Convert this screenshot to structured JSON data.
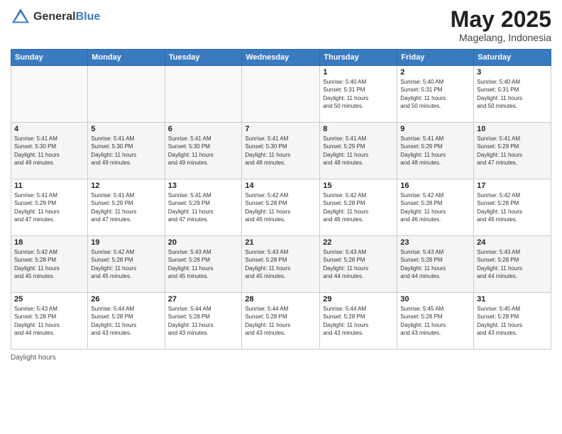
{
  "header": {
    "logo_general": "General",
    "logo_blue": "Blue",
    "month_year": "May 2025",
    "location": "Magelang, Indonesia"
  },
  "days_of_week": [
    "Sunday",
    "Monday",
    "Tuesday",
    "Wednesday",
    "Thursday",
    "Friday",
    "Saturday"
  ],
  "weeks": [
    [
      {
        "day": "",
        "info": ""
      },
      {
        "day": "",
        "info": ""
      },
      {
        "day": "",
        "info": ""
      },
      {
        "day": "",
        "info": ""
      },
      {
        "day": "1",
        "info": "Sunrise: 5:40 AM\nSunset: 5:31 PM\nDaylight: 11 hours\nand 50 minutes."
      },
      {
        "day": "2",
        "info": "Sunrise: 5:40 AM\nSunset: 5:31 PM\nDaylight: 11 hours\nand 50 minutes."
      },
      {
        "day": "3",
        "info": "Sunrise: 5:40 AM\nSunset: 5:31 PM\nDaylight: 11 hours\nand 50 minutes."
      }
    ],
    [
      {
        "day": "4",
        "info": "Sunrise: 5:41 AM\nSunset: 5:30 PM\nDaylight: 11 hours\nand 49 minutes."
      },
      {
        "day": "5",
        "info": "Sunrise: 5:41 AM\nSunset: 5:30 PM\nDaylight: 11 hours\nand 49 minutes."
      },
      {
        "day": "6",
        "info": "Sunrise: 5:41 AM\nSunset: 5:30 PM\nDaylight: 11 hours\nand 49 minutes."
      },
      {
        "day": "7",
        "info": "Sunrise: 5:41 AM\nSunset: 5:30 PM\nDaylight: 11 hours\nand 48 minutes."
      },
      {
        "day": "8",
        "info": "Sunrise: 5:41 AM\nSunset: 5:29 PM\nDaylight: 11 hours\nand 48 minutes."
      },
      {
        "day": "9",
        "info": "Sunrise: 5:41 AM\nSunset: 5:29 PM\nDaylight: 11 hours\nand 48 minutes."
      },
      {
        "day": "10",
        "info": "Sunrise: 5:41 AM\nSunset: 5:29 PM\nDaylight: 11 hours\nand 47 minutes."
      }
    ],
    [
      {
        "day": "11",
        "info": "Sunrise: 5:41 AM\nSunset: 5:29 PM\nDaylight: 11 hours\nand 47 minutes."
      },
      {
        "day": "12",
        "info": "Sunrise: 5:41 AM\nSunset: 5:29 PM\nDaylight: 11 hours\nand 47 minutes."
      },
      {
        "day": "13",
        "info": "Sunrise: 5:41 AM\nSunset: 5:29 PM\nDaylight: 11 hours\nand 47 minutes."
      },
      {
        "day": "14",
        "info": "Sunrise: 5:42 AM\nSunset: 5:28 PM\nDaylight: 11 hours\nand 46 minutes."
      },
      {
        "day": "15",
        "info": "Sunrise: 5:42 AM\nSunset: 5:28 PM\nDaylight: 11 hours\nand 46 minutes."
      },
      {
        "day": "16",
        "info": "Sunrise: 5:42 AM\nSunset: 5:28 PM\nDaylight: 11 hours\nand 46 minutes."
      },
      {
        "day": "17",
        "info": "Sunrise: 5:42 AM\nSunset: 5:28 PM\nDaylight: 11 hours\nand 46 minutes."
      }
    ],
    [
      {
        "day": "18",
        "info": "Sunrise: 5:42 AM\nSunset: 5:28 PM\nDaylight: 11 hours\nand 45 minutes."
      },
      {
        "day": "19",
        "info": "Sunrise: 5:42 AM\nSunset: 5:28 PM\nDaylight: 11 hours\nand 45 minutes."
      },
      {
        "day": "20",
        "info": "Sunrise: 5:43 AM\nSunset: 5:28 PM\nDaylight: 11 hours\nand 45 minutes."
      },
      {
        "day": "21",
        "info": "Sunrise: 5:43 AM\nSunset: 5:28 PM\nDaylight: 11 hours\nand 45 minutes."
      },
      {
        "day": "22",
        "info": "Sunrise: 5:43 AM\nSunset: 5:28 PM\nDaylight: 11 hours\nand 44 minutes."
      },
      {
        "day": "23",
        "info": "Sunrise: 5:43 AM\nSunset: 5:28 PM\nDaylight: 11 hours\nand 44 minutes."
      },
      {
        "day": "24",
        "info": "Sunrise: 5:43 AM\nSunset: 5:28 PM\nDaylight: 11 hours\nand 44 minutes."
      }
    ],
    [
      {
        "day": "25",
        "info": "Sunrise: 5:43 AM\nSunset: 5:28 PM\nDaylight: 11 hours\nand 44 minutes."
      },
      {
        "day": "26",
        "info": "Sunrise: 5:44 AM\nSunset: 5:28 PM\nDaylight: 11 hours\nand 43 minutes."
      },
      {
        "day": "27",
        "info": "Sunrise: 5:44 AM\nSunset: 5:28 PM\nDaylight: 11 hours\nand 43 minutes."
      },
      {
        "day": "28",
        "info": "Sunrise: 5:44 AM\nSunset: 5:28 PM\nDaylight: 11 hours\nand 43 minutes."
      },
      {
        "day": "29",
        "info": "Sunrise: 5:44 AM\nSunset: 5:28 PM\nDaylight: 11 hours\nand 43 minutes."
      },
      {
        "day": "30",
        "info": "Sunrise: 5:45 AM\nSunset: 5:28 PM\nDaylight: 11 hours\nand 43 minutes."
      },
      {
        "day": "31",
        "info": "Sunrise: 5:45 AM\nSunset: 5:28 PM\nDaylight: 11 hours\nand 43 minutes."
      }
    ]
  ],
  "footer": {
    "daylight_label": "Daylight hours"
  }
}
